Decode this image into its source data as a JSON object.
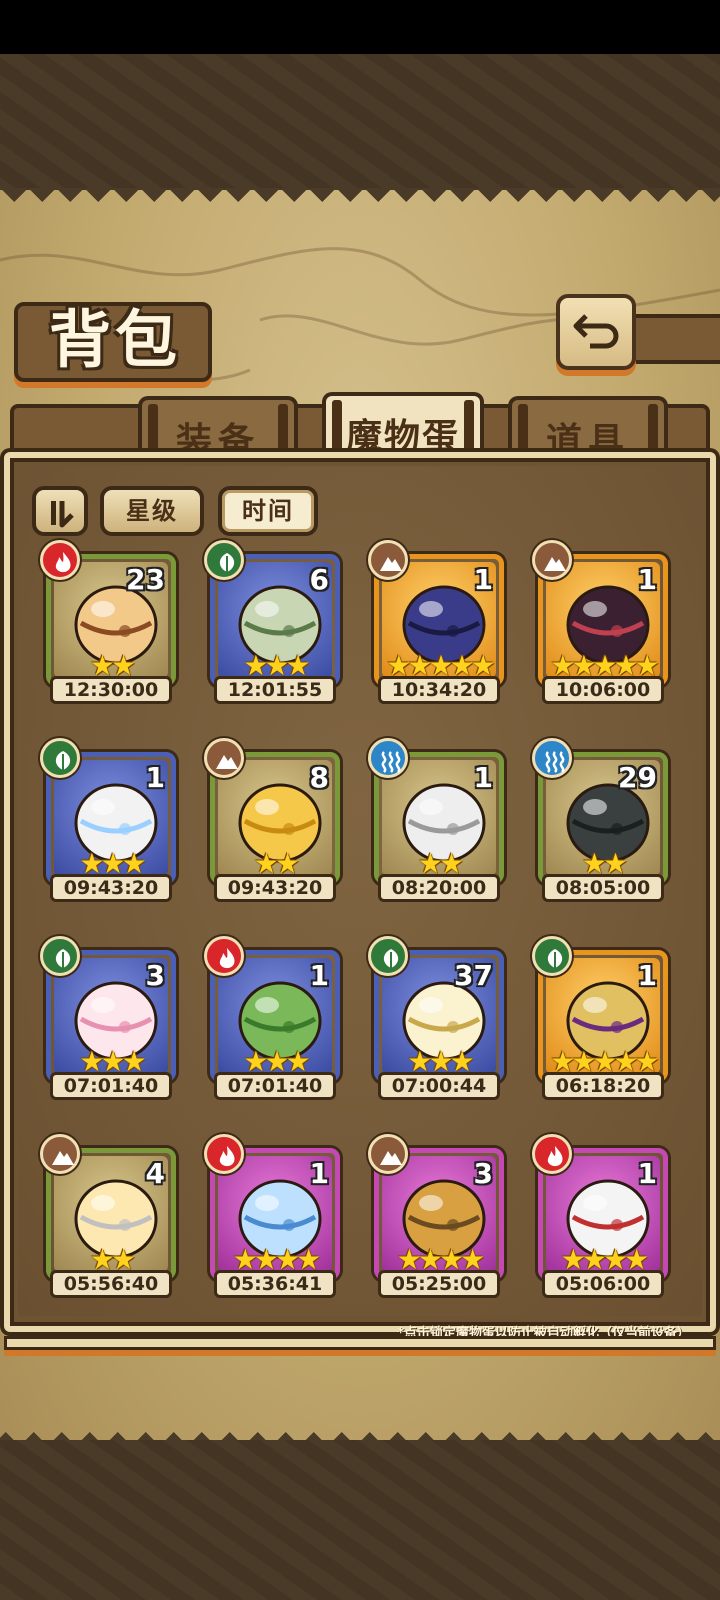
{
  "title": "背包",
  "tabs": [
    {
      "label": "装备",
      "active": false
    },
    {
      "label": "魔物蛋",
      "active": true
    },
    {
      "label": "道具",
      "active": false
    }
  ],
  "filters": {
    "star": "星级",
    "time": "时间",
    "active": "time"
  },
  "eggs": [
    {
      "element": "fire",
      "count": "23",
      "stars": 2,
      "timer": "12:30:00",
      "frame": "green"
    },
    {
      "element": "leaf",
      "count": "6",
      "stars": 3,
      "timer": "12:01:55",
      "frame": "blue"
    },
    {
      "element": "earth",
      "count": "1",
      "stars": 5,
      "timer": "10:34:20",
      "frame": "orange"
    },
    {
      "element": "earth",
      "count": "1",
      "stars": 5,
      "timer": "10:06:00",
      "frame": "orange"
    },
    {
      "element": "leaf",
      "count": "1",
      "stars": 3,
      "timer": "09:43:20",
      "frame": "blue"
    },
    {
      "element": "earth",
      "count": "8",
      "stars": 2,
      "timer": "09:43:20",
      "frame": "green"
    },
    {
      "element": "water",
      "count": "1",
      "stars": 2,
      "timer": "08:20:00",
      "frame": "green"
    },
    {
      "element": "water",
      "count": "29",
      "stars": 2,
      "timer": "08:05:00",
      "frame": "green"
    },
    {
      "element": "leaf",
      "count": "3",
      "stars": 3,
      "timer": "07:01:40",
      "frame": "blue"
    },
    {
      "element": "fire",
      "count": "1",
      "stars": 3,
      "timer": "07:01:40",
      "frame": "blue"
    },
    {
      "element": "leaf",
      "count": "37",
      "stars": 3,
      "timer": "07:00:44",
      "frame": "blue"
    },
    {
      "element": "leaf",
      "count": "1",
      "stars": 5,
      "timer": "06:18:20",
      "frame": "orange"
    },
    {
      "element": "earth",
      "count": "4",
      "stars": 2,
      "timer": "05:56:40",
      "frame": "green"
    },
    {
      "element": "fire",
      "count": "1",
      "stars": 4,
      "timer": "05:36:41",
      "frame": "purple"
    },
    {
      "element": "earth",
      "count": "3",
      "stars": 4,
      "timer": "05:25:00",
      "frame": "purple"
    },
    {
      "element": "fire",
      "count": "1",
      "stars": 4,
      "timer": "05:06:00",
      "frame": "purple"
    }
  ],
  "hint": "*点击锁定魔物蛋以防止被自动孵化（仅当前设备）",
  "colors": {
    "frame_green": "#7a9a3a",
    "frame_blue": "#4a5fb8",
    "frame_orange": "#e8951e",
    "frame_purple": "#c648b4",
    "fire": "#d8262a",
    "leaf": "#2f7a3a",
    "earth": "#8a5a3a",
    "water": "#2c86c8",
    "star": "#ffd21e"
  }
}
